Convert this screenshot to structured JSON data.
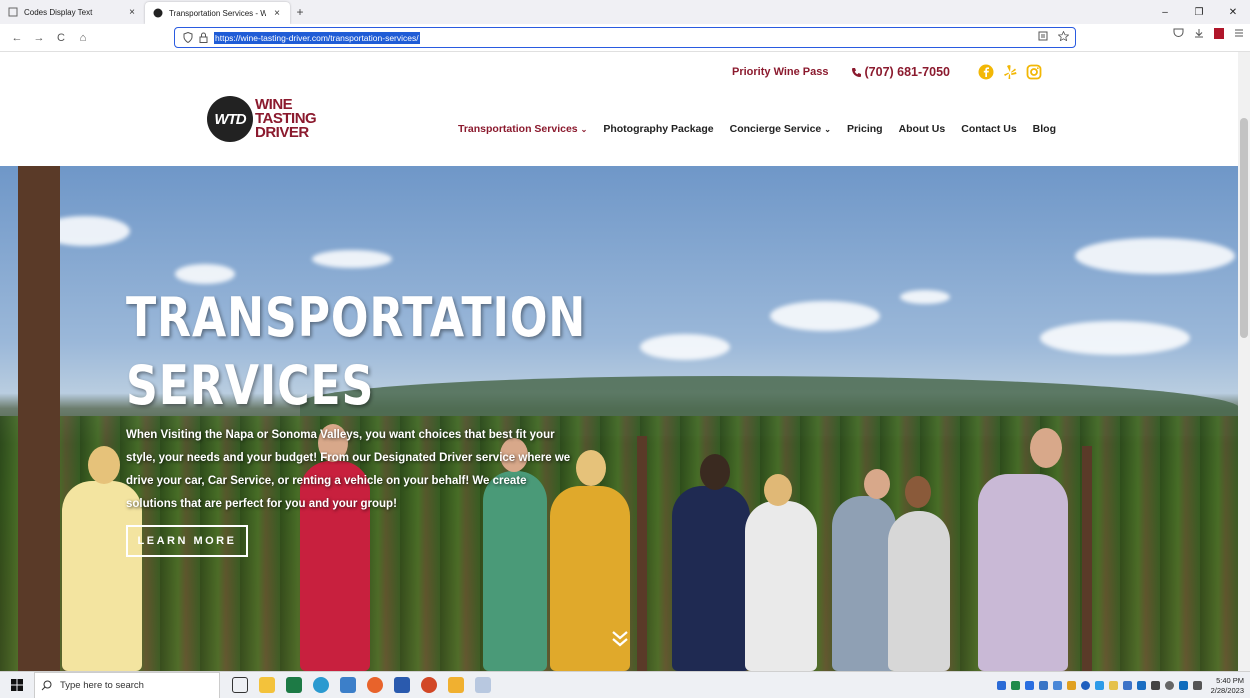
{
  "browser": {
    "tabs": [
      {
        "title": "Codes Display Text",
        "close": "×"
      },
      {
        "title": "Transportation Services - Wine T",
        "close": "×"
      }
    ],
    "new_tab": "+",
    "window_controls": {
      "minimize": "–",
      "restore": "❐",
      "close": "✕"
    },
    "nav": {
      "back": "←",
      "forward": "→",
      "reload": "C",
      "home": "⌂"
    },
    "url": "https://wine-tasting-driver.com/transportation-services/",
    "icons": [
      "shield-icon",
      "lock-icon",
      "reader-view-icon",
      "bookmark-star-icon",
      "pocket-icon",
      "download-icon",
      "pdf-extension-icon",
      "menu-icon"
    ]
  },
  "site": {
    "top_bar": {
      "priority_link": "Priority Wine Pass",
      "phone": "(707) 681-7050"
    },
    "logo": {
      "badge": "WTD",
      "line1": "WINE",
      "line2": "TASTING",
      "line3": "DRIVER"
    },
    "nav": [
      {
        "label": "Transportation Services",
        "dropdown": true,
        "active": true
      },
      {
        "label": "Photography Package",
        "dropdown": false
      },
      {
        "label": "Concierge Service",
        "dropdown": true
      },
      {
        "label": "Pricing",
        "dropdown": false
      },
      {
        "label": "About Us",
        "dropdown": false
      },
      {
        "label": "Contact Us",
        "dropdown": false
      },
      {
        "label": "Blog",
        "dropdown": false
      }
    ],
    "hero": {
      "title_line1": "TRANSPORTATION",
      "title_line2": "SERVICES",
      "body": "When Visiting the Napa or Sonoma Valleys, you want choices that best fit your style, your needs and your budget!  From our Designated Driver service where we drive your car, Car Service, or renting a vehicle on your behalf!  We create solutions that are perfect for you and your group!",
      "cta": "LEARN MORE"
    },
    "colors": {
      "brand": "#8b1a2e"
    }
  },
  "taskbar": {
    "search_placeholder": "Type here to search",
    "time": "5:40 PM",
    "date": "2/28/2023"
  }
}
